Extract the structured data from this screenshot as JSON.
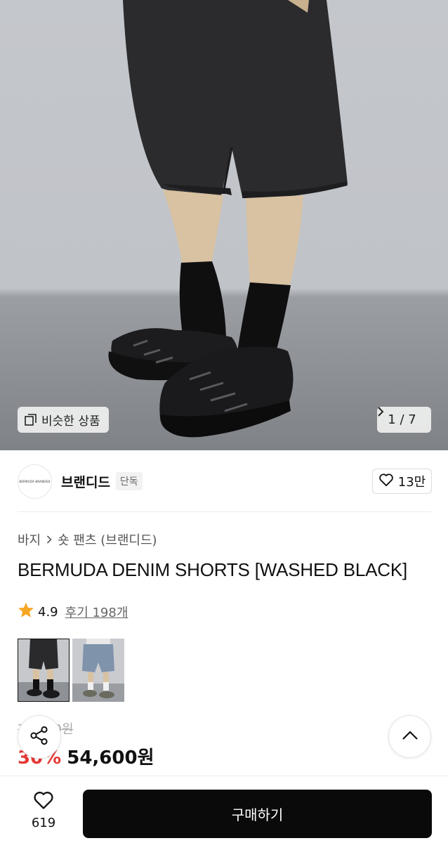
{
  "hero": {
    "similar_label": "비슷한 상품",
    "counter": "1 / 7",
    "icons": [
      "similar-icon",
      "chevron-right-icon"
    ]
  },
  "brand": {
    "logo_text": "BERMUDA BRANDED",
    "name": "브랜디드",
    "badge": "단독",
    "likes": "13만"
  },
  "breadcrumb": {
    "category": "바지",
    "subcategory": "숏 팬츠 (브랜디드)"
  },
  "product": {
    "title": "BERMUDA DENIM SHORTS [WASHED BLACK]",
    "rating": "4.9",
    "reviews": "후기 198개"
  },
  "price": {
    "original": "78,000원",
    "discount": "30%",
    "final": "54,600원"
  },
  "bottom_bar": {
    "wish_count": "619",
    "buy_label": "구매하기"
  },
  "colors": {
    "accent_red": "#e53935",
    "star": "#f5a623",
    "buy_button": "#0a0a0a"
  }
}
